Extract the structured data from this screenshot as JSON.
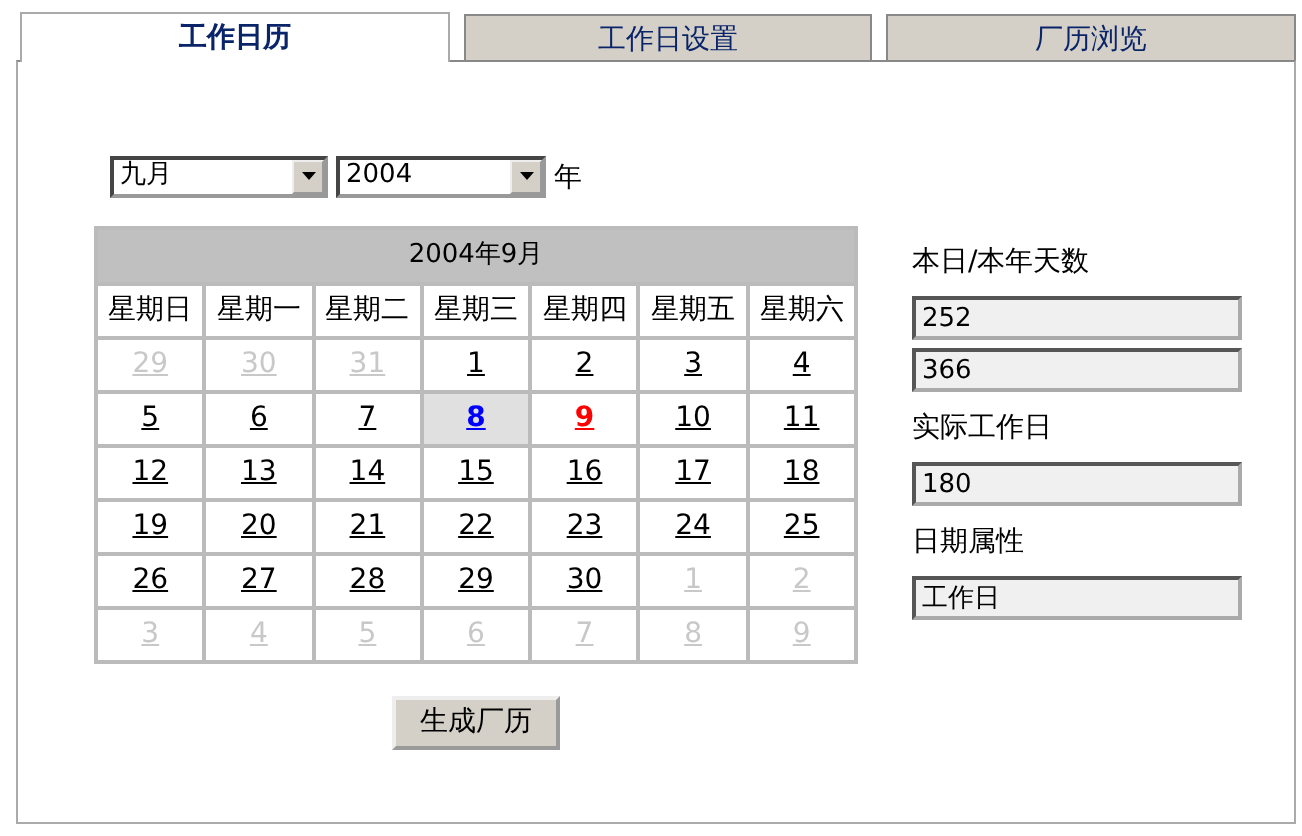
{
  "tabs": [
    {
      "label": "工作日历",
      "selected": true
    },
    {
      "label": "工作日设置",
      "selected": false
    },
    {
      "label": "厂历浏览",
      "selected": false
    }
  ],
  "month_select": {
    "value": "九月"
  },
  "year_select": {
    "value": "2004"
  },
  "year_suffix": "年",
  "calendar": {
    "title": "2004年9月",
    "weekdays": [
      "星期日",
      "星期一",
      "星期二",
      "星期三",
      "星期四",
      "星期五",
      "星期六"
    ],
    "weeks": [
      [
        {
          "day": "29",
          "kind": "outside",
          "selected": false
        },
        {
          "day": "30",
          "kind": "outside",
          "selected": false
        },
        {
          "day": "31",
          "kind": "outside",
          "selected": false
        },
        {
          "day": "1",
          "kind": "normal",
          "selected": false
        },
        {
          "day": "2",
          "kind": "normal",
          "selected": false
        },
        {
          "day": "3",
          "kind": "normal",
          "selected": false
        },
        {
          "day": "4",
          "kind": "normal",
          "selected": false
        }
      ],
      [
        {
          "day": "5",
          "kind": "normal",
          "selected": false
        },
        {
          "day": "6",
          "kind": "normal",
          "selected": false
        },
        {
          "day": "7",
          "kind": "normal",
          "selected": false
        },
        {
          "day": "8",
          "kind": "normal",
          "selected": true
        },
        {
          "day": "9",
          "kind": "today",
          "selected": false
        },
        {
          "day": "10",
          "kind": "normal",
          "selected": false
        },
        {
          "day": "11",
          "kind": "normal",
          "selected": false
        }
      ],
      [
        {
          "day": "12",
          "kind": "normal",
          "selected": false
        },
        {
          "day": "13",
          "kind": "normal",
          "selected": false
        },
        {
          "day": "14",
          "kind": "normal",
          "selected": false
        },
        {
          "day": "15",
          "kind": "normal",
          "selected": false
        },
        {
          "day": "16",
          "kind": "normal",
          "selected": false
        },
        {
          "day": "17",
          "kind": "normal",
          "selected": false
        },
        {
          "day": "18",
          "kind": "normal",
          "selected": false
        }
      ],
      [
        {
          "day": "19",
          "kind": "normal",
          "selected": false
        },
        {
          "day": "20",
          "kind": "normal",
          "selected": false
        },
        {
          "day": "21",
          "kind": "normal",
          "selected": false
        },
        {
          "day": "22",
          "kind": "normal",
          "selected": false
        },
        {
          "day": "23",
          "kind": "normal",
          "selected": false
        },
        {
          "day": "24",
          "kind": "normal",
          "selected": false
        },
        {
          "day": "25",
          "kind": "normal",
          "selected": false
        }
      ],
      [
        {
          "day": "26",
          "kind": "normal",
          "selected": false
        },
        {
          "day": "27",
          "kind": "normal",
          "selected": false
        },
        {
          "day": "28",
          "kind": "normal",
          "selected": false
        },
        {
          "day": "29",
          "kind": "normal",
          "selected": false
        },
        {
          "day": "30",
          "kind": "normal",
          "selected": false
        },
        {
          "day": "1",
          "kind": "outside",
          "selected": false
        },
        {
          "day": "2",
          "kind": "outside",
          "selected": false
        }
      ],
      [
        {
          "day": "3",
          "kind": "outside",
          "selected": false
        },
        {
          "day": "4",
          "kind": "outside",
          "selected": false
        },
        {
          "day": "5",
          "kind": "outside",
          "selected": false
        },
        {
          "day": "6",
          "kind": "outside",
          "selected": false
        },
        {
          "day": "7",
          "kind": "outside",
          "selected": false
        },
        {
          "day": "8",
          "kind": "outside",
          "selected": false
        },
        {
          "day": "9",
          "kind": "outside",
          "selected": false
        }
      ]
    ]
  },
  "side_panel": [
    {
      "label": "本日/本年天数",
      "values": [
        "252",
        "366"
      ]
    },
    {
      "label": "实际工作日",
      "values": [
        "180"
      ]
    },
    {
      "label": "日期属性",
      "values": [
        "工作日"
      ]
    }
  ],
  "generate_button": "生成厂历"
}
